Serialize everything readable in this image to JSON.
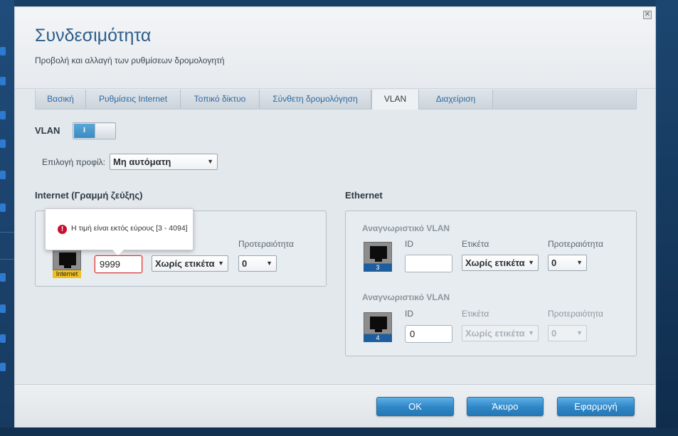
{
  "dialog": {
    "title": "Συνδεσιμότητα",
    "subtitle": "Προβολή και αλλαγή των ρυθμίσεων δρομολογητή",
    "close_icon": "close-icon"
  },
  "tabs": [
    {
      "label": "Βασική",
      "active": false
    },
    {
      "label": "Ρυθμίσεις Internet",
      "active": false
    },
    {
      "label": "Τοπικό δίκτυο",
      "active": false
    },
    {
      "label": "Σύνθετη δρομολόγηση",
      "active": false
    },
    {
      "label": "VLAN",
      "active": true
    },
    {
      "label": "Διαχείριση",
      "active": false
    }
  ],
  "vlan": {
    "label": "VLAN",
    "toggle_on_text": "I",
    "enabled": true
  },
  "profile": {
    "label": "Επιλογή προφίλ:",
    "value": "Μη αυτόματη"
  },
  "internet": {
    "title": "Internet (Γραμμή ζεύξης)",
    "port_label": "Internet",
    "id_value": "9999",
    "tag_value": "Χωρίς ετικέτα",
    "priority_label": "Προτεραιότητα",
    "priority_value": "0",
    "error_tooltip": "Η τιμή είναι εκτός εύρους [3 - 4094]"
  },
  "ethernet": {
    "title": "Ethernet",
    "rows": [
      {
        "title": "Αναγνωριστικό VLAN",
        "port_number": "3",
        "id_label": "ID",
        "id_value": "",
        "tag_label": "Ετικέτα",
        "tag_value": "Χωρίς ετικέτα",
        "priority_label": "Προτεραιότητα",
        "priority_value": "0",
        "disabled": false
      },
      {
        "title": "Αναγνωριστικό VLAN",
        "port_number": "4",
        "id_label": "ID",
        "id_value": "0",
        "tag_label": "Ετικέτα",
        "tag_value": "Χωρίς ετικέτα",
        "priority_label": "Προτεραιότητα",
        "priority_value": "0",
        "disabled": true
      }
    ]
  },
  "footer": {
    "ok_label": "OK",
    "cancel_label": "Άκυρο",
    "apply_label": "Εφαρμογή"
  },
  "colors": {
    "accent": "#2f86c6",
    "title": "#2c5d8a",
    "error": "#c8102e"
  }
}
